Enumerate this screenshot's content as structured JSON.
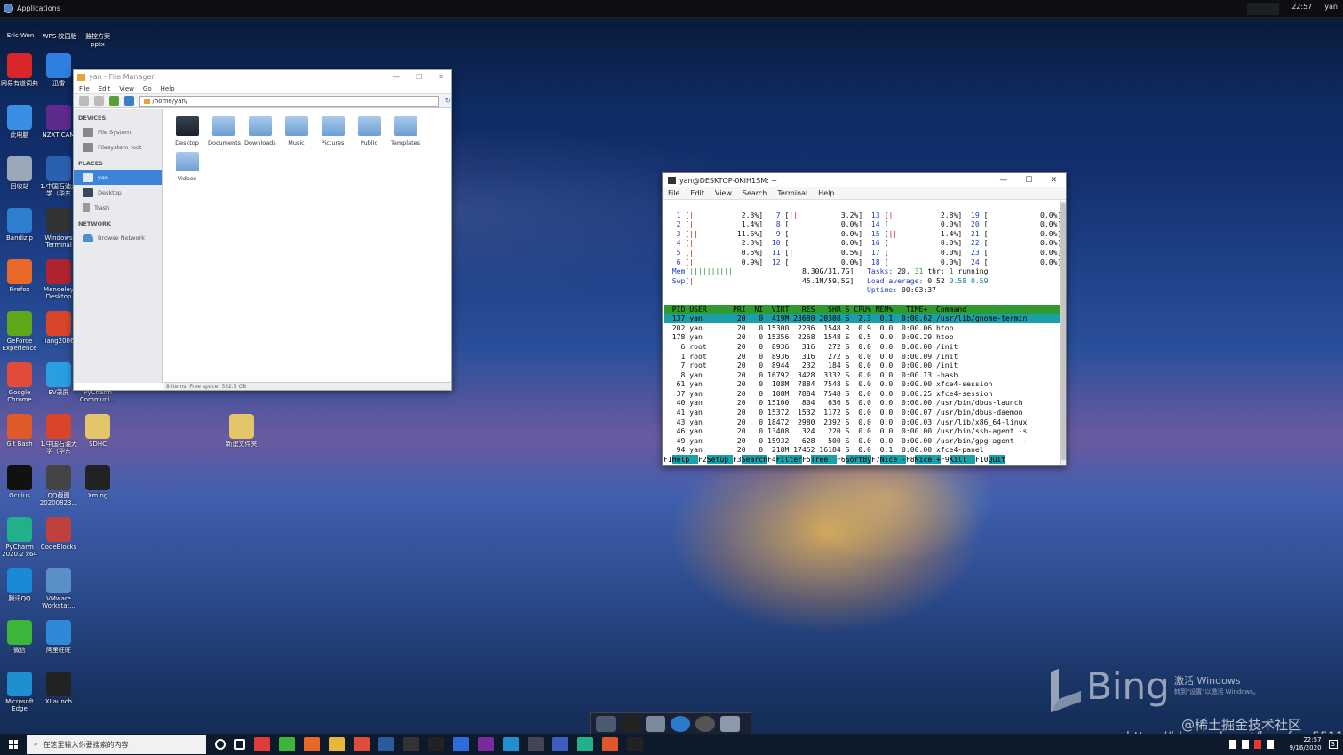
{
  "topbar": {
    "applications_label": "Applications",
    "time": "22:57",
    "user": "yan"
  },
  "desktop_top_labels": [
    "Eric Wen",
    "WPS 校园版",
    "监控方案pptx"
  ],
  "desktop_icons": [
    {
      "label": "网易有道词典",
      "color": "#d8262b"
    },
    {
      "label": "迅雷",
      "color": "#2f7fe0"
    },
    {
      "label": "此电脑",
      "color": "#3a8ee6"
    },
    {
      "label": "NZXT CAM",
      "color": "#5e2a8c"
    },
    {
      "label": "回收站",
      "color": "#9aa8b8"
    },
    {
      "label": "1.中国石油大学（华东",
      "color": "#2b5fb0"
    },
    {
      "label": "Bandizip",
      "color": "#2f7fd0"
    },
    {
      "label": "Windows Terminal",
      "color": "#333"
    },
    {
      "label": "Firefox",
      "color": "#e8682a"
    },
    {
      "label": "Mendeley Desktop",
      "color": "#b02430"
    },
    {
      "label": "GeForce Experience",
      "color": "#5fa81c"
    },
    {
      "label": "liang2006",
      "color": "#d9452a"
    },
    {
      "label": "Google Chrome",
      "color": "#e04b3a"
    },
    {
      "label": "EV录屏",
      "color": "#2a9ee0"
    },
    {
      "label": "PyCharm Communi...",
      "color": "#21d789"
    },
    {
      "label": "Git Bash",
      "color": "#e05a2a"
    },
    {
      "label": "1.中国石油大学（华东",
      "color": "#d9452a"
    },
    {
      "label": "SDHC",
      "color": "#e5c56a"
    },
    {
      "label": "新建文件夹",
      "color": "#e5c56a"
    },
    {
      "label": "Oculus",
      "color": "#111"
    },
    {
      "label": "QQ截图20200823...",
      "color": "#444"
    },
    {
      "label": "Xming",
      "color": "#222"
    },
    {
      "label": "PyCharm 2020.2 x64",
      "color": "#21b08a"
    },
    {
      "label": "CodeBlocks",
      "color": "#c04040"
    },
    {
      "label": "腾讯QQ",
      "color": "#1a8ad8"
    },
    {
      "label": "VMware Workstat...",
      "color": "#5b8fc8"
    },
    {
      "label": "微信",
      "color": "#3bb53a"
    },
    {
      "label": "阿里旺旺",
      "color": "#2e8ad8"
    },
    {
      "label": "Microsoft Edge",
      "color": "#1f8fd0"
    },
    {
      "label": "XLaunch",
      "color": "#222"
    }
  ],
  "file_manager": {
    "title": "yan - File Manager",
    "controls": [
      "—",
      "☐",
      "✕"
    ],
    "menu": [
      "File",
      "Edit",
      "View",
      "Go",
      "Help"
    ],
    "address": "/home/yan/",
    "sections": {
      "devices": {
        "heading": "DEVICES",
        "items": [
          "File System",
          "Filesystem root"
        ]
      },
      "places": {
        "heading": "PLACES",
        "items": [
          "yan",
          "Desktop",
          "Trash"
        ]
      },
      "network": {
        "heading": "NETWORK",
        "items": [
          "Browse Network"
        ]
      }
    },
    "folders": [
      "Desktop",
      "Documents",
      "Downloads",
      "Music",
      "Pictures",
      "Public",
      "Templates",
      "Videos"
    ],
    "status": "8 items, Free space: 332.5 GB"
  },
  "terminal": {
    "title": "yan@DESKTOP-0KIH1SM: ~",
    "controls": [
      "—",
      "☐",
      "✕"
    ],
    "menu": [
      "File",
      "Edit",
      "View",
      "Search",
      "Terminal",
      "Help"
    ],
    "cpus": [
      [
        "1",
        "[|",
        "2.3%]",
        "7",
        "[||",
        "3.2%]",
        "13",
        "[|",
        "2.8%]",
        "19",
        "[",
        "0.0%]"
      ],
      [
        "2",
        "[|",
        "1.4%]",
        "8",
        "[",
        "0.0%]",
        "14",
        "[",
        "0.0%]",
        "20",
        "[",
        "0.0%]"
      ],
      [
        "3",
        "[||",
        "11.6%]",
        "9",
        "[",
        "0.0%]",
        "15",
        "[||",
        "1.4%]",
        "21",
        "[",
        "0.0%]"
      ],
      [
        "4",
        "[|",
        "2.3%]",
        "10",
        "[",
        "0.0%]",
        "16",
        "[",
        "0.0%]",
        "22",
        "[",
        "0.0%]"
      ],
      [
        "5",
        "[|",
        "0.5%]",
        "11",
        "[|",
        "0.5%]",
        "17",
        "[",
        "0.0%]",
        "23",
        "[",
        "0.0%]"
      ],
      [
        "6",
        "[|",
        "0.9%]",
        "12",
        "[",
        "0.0%]",
        "18",
        "[",
        "0.0%]",
        "24",
        "[",
        "0.0%]"
      ]
    ],
    "mem": {
      "label": "Mem[",
      "bar": "||||||||||",
      "value": "8.30G/31.7G]"
    },
    "swp": {
      "label": "Swp[",
      "bar": "|",
      "value": "45.1M/59.5G]"
    },
    "tasks": {
      "prefix": "Tasks:",
      "a": "20,",
      "b": "31",
      "mid": "thr;",
      "c": "1",
      "suffix": "running"
    },
    "load": {
      "prefix": "Load average:",
      "a": "0.52",
      "b": "0.58",
      "c": "0.59"
    },
    "uptime": {
      "prefix": "Uptime:",
      "value": "00:03:37"
    },
    "header": "  PID USER      PRI  NI  VIRT   RES   SHR S CPU% MEM%   TIME+  Command",
    "procs": [
      "  137 yan        20   0  419M 23680 20308 S  2.3  0.1  0:00.62 /usr/lib/gnome-termin",
      "  202 yan        20   0 15300  2236  1548 R  0.9  0.0  0:00.06 htop",
      "  178 yan        20   0 15356  2268  1548 S  0.5  0.0  0:00.29 htop",
      "    6 root       20   0  8936   316   272 S  0.0  0.0  0:00.00 /init",
      "    1 root       20   0  8936   316   272 S  0.0  0.0  0:00.09 /init",
      "    7 root       20   0  8944   232   184 S  0.0  0.0  0:00.00 /init",
      "    8 yan        20   0 16792  3428  3332 S  0.0  0.0  0:00.13 -bash",
      "   61 yan        20   0  108M  7884  7548 S  0.0  0.0  0:00.00 xfce4-session",
      "   37 yan        20   0  108M  7884  7548 S  0.0  0.0  0:00.25 xfce4-session",
      "   40 yan        20   0 15100   804   636 S  0.0  0.0  0:00.00 /usr/bin/dbus-launch",
      "   41 yan        20   0 15372  1532  1172 S  0.0  0.0  0:00.07 /usr/bin/dbus-daemon",
      "   43 yan        20   0 18472  2980  2392 S  0.0  0.0  0:00.03 /usr/lib/x86_64-linux",
      "   46 yan        20   0 13408   324   220 S  0.0  0.0  0:00.00 /usr/bin/ssh-agent -s",
      "   49 yan        20   0 15932   628   500 S  0.0  0.0  0:00.00 /usr/bin/gpg-agent --",
      "   94 yan        20   0  218M 17452 16184 S  0.0  0.1  0:00.00 xfce4-panel"
    ],
    "fkeys": [
      {
        "k": "F1",
        "l": "Help  "
      },
      {
        "k": "F2",
        "l": "Setup "
      },
      {
        "k": "F3",
        "l": "Search"
      },
      {
        "k": "F4",
        "l": "Filter"
      },
      {
        "k": "F5",
        "l": "Tree  "
      },
      {
        "k": "F6",
        "l": "SortBy"
      },
      {
        "k": "F7",
        "l": "Nice -"
      },
      {
        "k": "F8",
        "l": "Nice +"
      },
      {
        "k": "F9",
        "l": "Kill  "
      },
      {
        "k": "F10",
        "l": "Quit"
      }
    ]
  },
  "watermark": {
    "bing": "Bing",
    "activate_title": "激活 Windows",
    "activate_sub": "转到\"设置\"以激活 Windows。",
    "site": "@稀土掘金技术社区",
    "url": "https://blog.csdn.net/bornfree5511"
  },
  "taskbar": {
    "search_placeholder": "在这里输入你要搜索的内容",
    "icons": [
      "cortana-icon",
      "task-view-icon",
      "qq-icon",
      "wechat-icon",
      "firefox-icon",
      "explorer-icon",
      "chrome-icon",
      "powershell-icon",
      "terminal-icon",
      "cmd-icon",
      "feishu-icon",
      "onenote-icon",
      "vscode-icon",
      "xfce-icon",
      "vpn-icon",
      "pycharm-icon",
      "ubuntu-icon",
      "xming-icon"
    ],
    "time": "22:57",
    "date": "9/16/2020",
    "notification_count": "3"
  }
}
